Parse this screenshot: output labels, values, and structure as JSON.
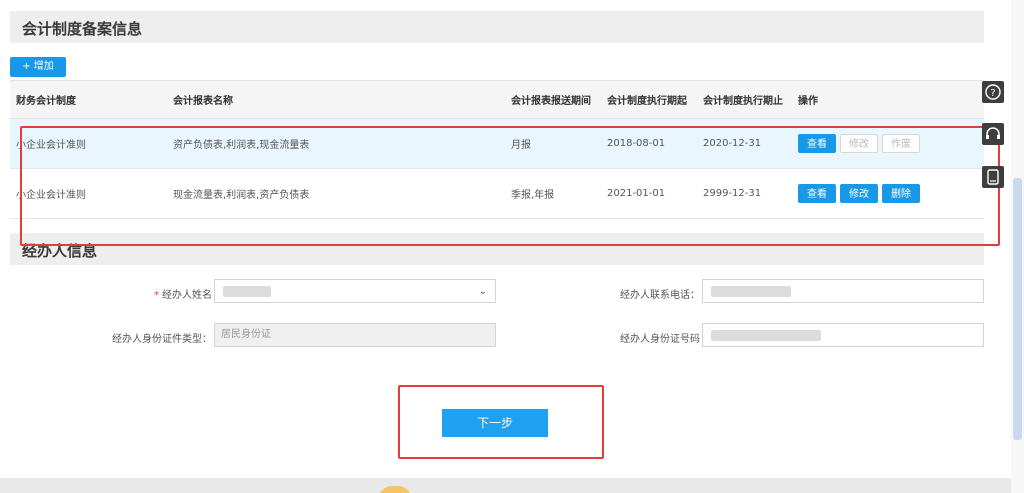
{
  "section1": {
    "title": "会计制度备案信息",
    "add_label": "+ 增加"
  },
  "table": {
    "headers": [
      "财务会计制度",
      "会计报表名称",
      "会计报表报送期间",
      "会计制度执行期起",
      "会计制度执行期止",
      "操作"
    ],
    "rows": [
      {
        "system": "小企业会计准则",
        "reports": "资产负债表,利润表,现金流量表",
        "period": "月报",
        "start": "2018-08-01",
        "end": "2020-12-31",
        "actions": [
          "查看",
          "修改",
          "作废"
        ]
      },
      {
        "system": "小企业会计准则",
        "reports": "现金流量表,利润表,资产负债表",
        "period": "季报,年报",
        "start": "2021-01-01",
        "end": "2999-12-31",
        "actions": [
          "查看",
          "修改",
          "删除"
        ]
      }
    ]
  },
  "section2": {
    "title": "经办人信息",
    "name_label": "经办人姓名",
    "required_mark": "*",
    "phone_label": "经办人联系电话：",
    "idtype_label": "经办人身份证件类型：",
    "idtype_value": "居民身份证",
    "idnum_label": "经办人身份证号码"
  },
  "next_label": "下一步",
  "icons": {
    "help": "question-circle-icon",
    "support": "headset-icon",
    "mobile": "tablet-icon"
  },
  "colors": {
    "primary": "#1a98e8",
    "highlight_border": "#e43c3c"
  }
}
